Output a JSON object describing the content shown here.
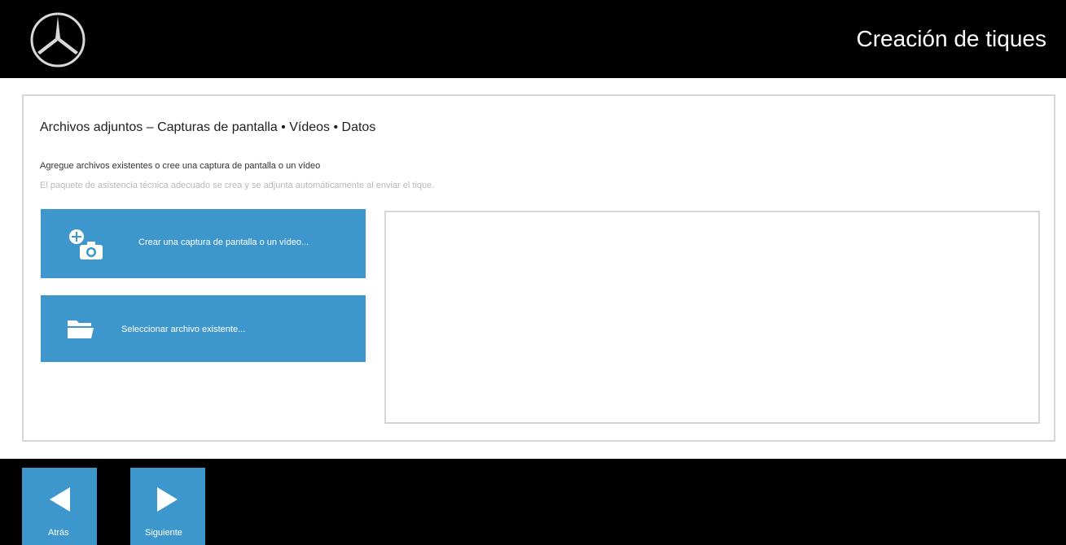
{
  "header": {
    "title": "Creación de tiques",
    "logo_icon": "mercedes-star-icon"
  },
  "attachments": {
    "section_title": "Archivos adjuntos – Capturas de pantalla • Vídeos • Datos",
    "instruction": "Agregue archivos existentes o cree una captura de pantalla o un vídeo",
    "note": "El paquete de asistencia técnica adecuado se crea y se adjunta automáticamente al enviar el tique.",
    "capture_button": {
      "label": "Crear una captura de pantalla o un vídeo...",
      "icon": "add-camera-icon"
    },
    "select_button": {
      "label": "Seleccionar archivo existente...",
      "icon": "folder-icon"
    }
  },
  "footer": {
    "back": {
      "label": "Atrás",
      "icon": "arrow-left-icon"
    },
    "next": {
      "label": "Siguiente",
      "icon": "arrow-right-icon"
    }
  },
  "colors": {
    "bar_background": "#000000",
    "accent": "#3d97cd",
    "border": "#d6d6d6",
    "muted_text": "#b8b8b8"
  }
}
